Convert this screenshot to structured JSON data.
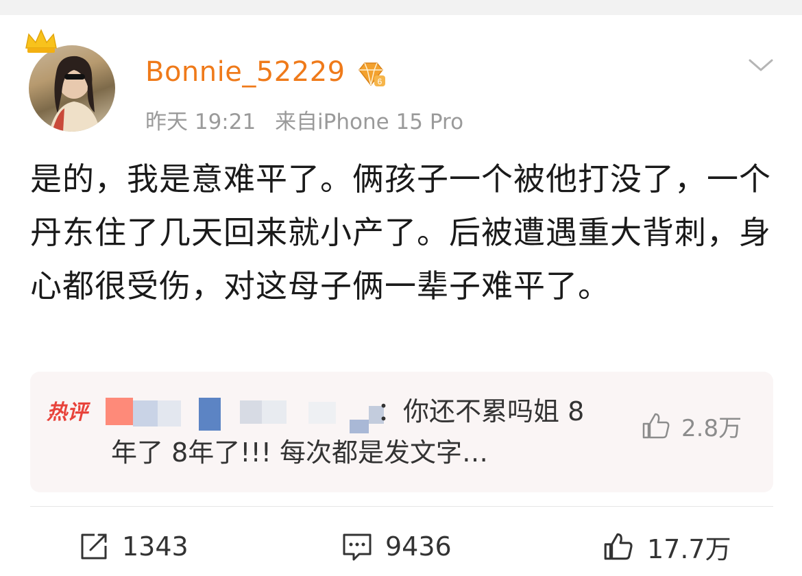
{
  "post": {
    "username": "Bonnie_52229",
    "vip_level": "6",
    "time": "昨天 19:21",
    "source": "来自iPhone 15 Pro",
    "text": "是的，我是意难平了。俩孩子一个被他打没了，一个丹东住了几天回来就小产了。后被遭遇重大背刺，身心都很受伤，对这母子俩一辈子难平了。"
  },
  "hot_comment": {
    "label": "热评",
    "text_line1": "：你还不累吗姐 8",
    "text_line2": "年了 8年了!!! 每次都是发文字…",
    "likes": "2.8万"
  },
  "actions": {
    "repost_count": "1343",
    "comment_count": "9436",
    "like_count": "17.7万"
  },
  "colors": {
    "username": "#ef7a1a",
    "hot_label": "#e8433b",
    "meta": "#9a9a9a"
  },
  "icons": {
    "crown": "crown-icon",
    "vip": "vip-diamond-icon",
    "chevron": "chevron-down-icon",
    "thumb": "thumb-up-icon",
    "repost": "repost-icon",
    "comment": "comment-icon"
  }
}
